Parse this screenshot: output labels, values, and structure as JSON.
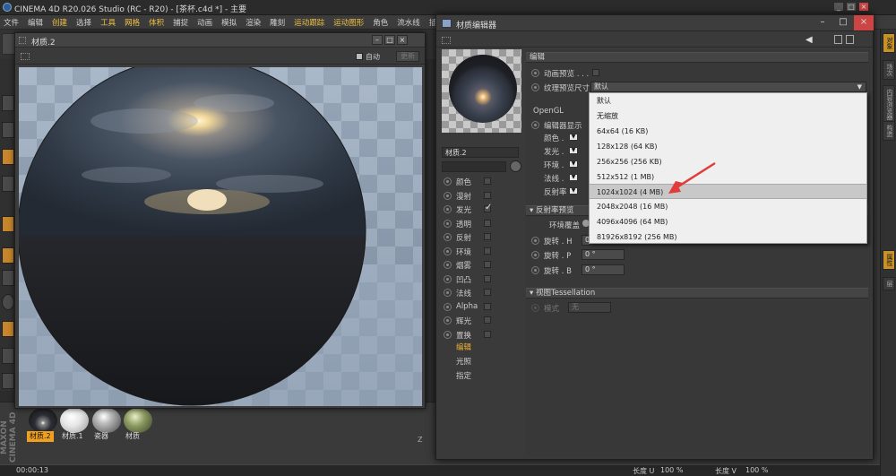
{
  "app": {
    "title": "CINEMA 4D R20.026 Studio (RC - R20) - [茶杯.c4d *] - 主要",
    "status_time": "00:00:13"
  },
  "menu": [
    {
      "label": "文件",
      "hl": false
    },
    {
      "label": "编辑",
      "hl": false
    },
    {
      "label": "创建",
      "hl": true
    },
    {
      "label": "选择",
      "hl": false
    },
    {
      "label": "工具",
      "hl": true
    },
    {
      "label": "网格",
      "hl": true
    },
    {
      "label": "体积",
      "hl": true
    },
    {
      "label": "捕捉",
      "hl": false
    },
    {
      "label": "动画",
      "hl": false
    },
    {
      "label": "模拟",
      "hl": false
    },
    {
      "label": "渲染",
      "hl": false
    },
    {
      "label": "雕刻",
      "hl": false
    },
    {
      "label": "运动跟踪",
      "hl": true
    },
    {
      "label": "运动图形",
      "hl": true
    },
    {
      "label": "角色",
      "hl": false
    },
    {
      "label": "流水线",
      "hl": false
    },
    {
      "label": "插件",
      "hl": false
    }
  ],
  "preview_window": {
    "title": "材质.2",
    "auto_label": "自动",
    "refresh_label": "更新"
  },
  "material_manager": {
    "items": [
      {
        "label": "材质.2",
        "active": true
      },
      {
        "label": "材质.1",
        "active": false
      },
      {
        "label": "瓷器",
        "active": false
      },
      {
        "label": "材质",
        "active": false
      }
    ]
  },
  "editor": {
    "title": "材质编辑器",
    "material_name": "材质.2",
    "channels": [
      {
        "label": "颜色",
        "checked": false
      },
      {
        "label": "漫射",
        "checked": false
      },
      {
        "label": "发光",
        "checked": true
      },
      {
        "label": "透明",
        "checked": false
      },
      {
        "label": "反射",
        "checked": false
      },
      {
        "label": "环境",
        "checked": false
      },
      {
        "label": "烟雾",
        "checked": false
      },
      {
        "label": "凹凸",
        "checked": false
      },
      {
        "label": "法线",
        "checked": false
      },
      {
        "label": "Alpha",
        "checked": false
      },
      {
        "label": "辉光",
        "checked": false
      },
      {
        "label": "置换",
        "checked": false
      }
    ],
    "tabs": [
      {
        "label": "编辑",
        "active": true
      },
      {
        "label": "光照",
        "active": false
      },
      {
        "label": "指定",
        "active": false
      }
    ],
    "edit_section_label": "编辑",
    "anim_preview_label": "动画预览 . . .",
    "texture_preview_size_label": "纹理预览尺寸",
    "texture_preview_size_value": "默认",
    "opengl_label": "OpenGL",
    "editor_display_label": "编辑器显示",
    "gl_rows": [
      "颜色 .",
      "发光 .",
      "环境 .",
      "法线 .",
      "反射率"
    ],
    "reflectance_preview_label": "反射率预览",
    "env_overlay_label": "环境覆盖",
    "rotation_h_label": "旋转 . H",
    "rotation_p_label": "旋转 . P",
    "rotation_b_label": "旋转 . B",
    "rotation_h_value": "0",
    "rotation_p_value": "0 °",
    "rotation_b_value": "0 °",
    "viewport_tess_label": "视图Tessellation",
    "mode_label": "模式",
    "mode_value": "无"
  },
  "dropdown": {
    "options": [
      {
        "label": "默认",
        "selected": false
      },
      {
        "label": "无缩放",
        "selected": false
      },
      {
        "label": "64x64 (16 KB)",
        "selected": false
      },
      {
        "label": "128x128 (64 KB)",
        "selected": false
      },
      {
        "label": "256x256 (256 KB)",
        "selected": false
      },
      {
        "label": "512x512 (1 MB)",
        "selected": false
      },
      {
        "label": "1024x1024 (4 MB)",
        "selected": true
      },
      {
        "label": "2048x2048 (16 MB)",
        "selected": false
      },
      {
        "label": "4096x4096 (64 MB)",
        "selected": false
      },
      {
        "label": "81926x8192 (256 MB)",
        "selected": false
      }
    ]
  },
  "right_tabs": [
    {
      "label": "对象",
      "active": true
    },
    {
      "label": "场次",
      "active": false
    },
    {
      "label": "内容浏览器",
      "active": false
    },
    {
      "label": "构造",
      "active": false
    },
    {
      "label": "属性",
      "active": true
    },
    {
      "label": "层",
      "active": false
    }
  ],
  "bottom_coords": {
    "z_label": "Z",
    "length_u_label": "长度 U",
    "length_u_value": "100 %",
    "length_v_label": "长度 V",
    "length_v_value": "100 %"
  },
  "branding": "MAXON CINEMA 4D",
  "colors": {
    "accent": "#f0b230",
    "arrow": "#e23b3b",
    "dropdown_sel": "#c8c8c8"
  }
}
